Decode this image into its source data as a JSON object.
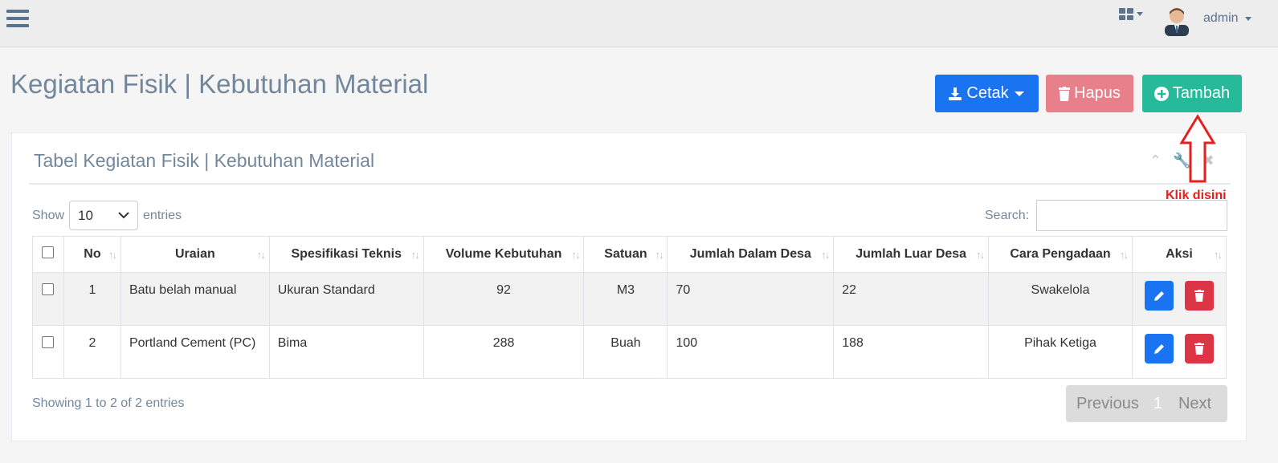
{
  "header": {
    "user": "admin"
  },
  "page": {
    "title": "Kegiatan Fisik | Kebutuhan Material"
  },
  "buttons": {
    "cetak": "Cetak",
    "hapus": "Hapus",
    "tambah": "Tambah"
  },
  "panel": {
    "title": "Tabel Kegiatan Fisik | Kebutuhan Material"
  },
  "controls": {
    "show": "Show",
    "entries_value": "10",
    "entries": "entries",
    "search": "Search:"
  },
  "table": {
    "headers": [
      "No",
      "Uraian",
      "Spesifikasi Teknis",
      "Volume Kebutuhan",
      "Satuan",
      "Jumlah Dalam Desa",
      "Jumlah Luar Desa",
      "Cara Pengadaan",
      "Aksi"
    ],
    "rows": [
      [
        "1",
        "Batu belah manual",
        "Ukuran Standard",
        "92",
        "M3",
        "70",
        "22",
        "Swakelola"
      ],
      [
        "2",
        "Portland Cement (PC)",
        "Bima",
        "288",
        "Buah",
        "100",
        "188",
        "Pihak Ketiga"
      ]
    ]
  },
  "footer": {
    "info": "Showing 1 to 2 of 2 entries",
    "previous": "Previous",
    "page": "1",
    "next": "Next"
  },
  "annotation": {
    "text": "Klik disini"
  },
  "colors": {
    "primary": "#1a73f0",
    "danger": "#dc3545",
    "success": "#26b99a",
    "annotation": "#e5201f"
  }
}
